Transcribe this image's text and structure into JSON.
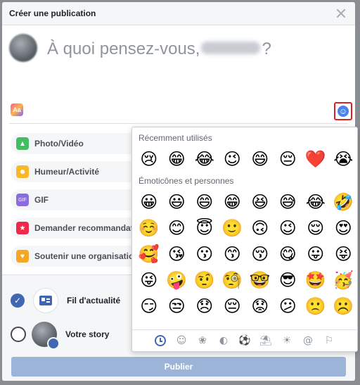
{
  "modal": {
    "title": "Créer une publication",
    "close_icon": "close-icon"
  },
  "composer": {
    "prompt_prefix": "À quoi pensez-vous,",
    "prompt_suffix": "?",
    "text_style_label": "Aa"
  },
  "actions": [
    {
      "label": "Photo/Vidéo",
      "icon": "photo-icon",
      "color": "#45bd62",
      "glyph": "▲"
    },
    {
      "label": "Humeur/Activité",
      "icon": "smiley-icon",
      "color": "#f7b928",
      "glyph": "☻"
    },
    {
      "label": "GIF",
      "icon": "gif-icon",
      "color": "#8c6de0",
      "glyph": "GIF"
    },
    {
      "label": "Demander recommandations",
      "icon": "recommend-icon",
      "color": "#f02849",
      "glyph": "★"
    },
    {
      "label": "Soutenir une organisation",
      "icon": "fundraiser-icon",
      "color": "#f5a623",
      "glyph": "♥"
    }
  ],
  "share": {
    "feed_label": "Fil d'actualité",
    "story_label": "Votre story"
  },
  "publish_label": "Publier",
  "picker": {
    "recent_label": "Récemment utilisés",
    "recent": [
      "😢",
      "😁",
      "😂",
      "😉",
      "😄",
      "😔",
      "❤️",
      "😭"
    ],
    "people_label": "Émoticônes et personnes",
    "people": [
      "😀",
      "😃",
      "😄",
      "😁",
      "😆",
      "😅",
      "😂",
      "🤣",
      "☺️",
      "😊",
      "😇",
      "🙂",
      "🙃",
      "😉",
      "😌",
      "😍",
      "🥰",
      "😘",
      "😗",
      "😙",
      "😚",
      "😋",
      "😛",
      "😝",
      "😜",
      "🤪",
      "🤨",
      "🧐",
      "🤓",
      "😎",
      "🤩",
      "🥳",
      "😏",
      "😒",
      "😞",
      "😔",
      "😟",
      "😕",
      "🙁",
      "☹️"
    ],
    "categories": [
      {
        "name": "recent-icon",
        "glyph": ""
      },
      {
        "name": "smiley-category-icon",
        "glyph": "☺"
      },
      {
        "name": "paw-icon",
        "glyph": "❀"
      },
      {
        "name": "apple-icon",
        "glyph": "◐"
      },
      {
        "name": "ball-icon",
        "glyph": "⚽"
      },
      {
        "name": "beach-umbrella-icon",
        "glyph": "⛱"
      },
      {
        "name": "lightbulb-icon",
        "glyph": "☀"
      },
      {
        "name": "at-symbol-icon",
        "glyph": "@"
      },
      {
        "name": "flag-icon",
        "glyph": "⚐"
      }
    ]
  }
}
